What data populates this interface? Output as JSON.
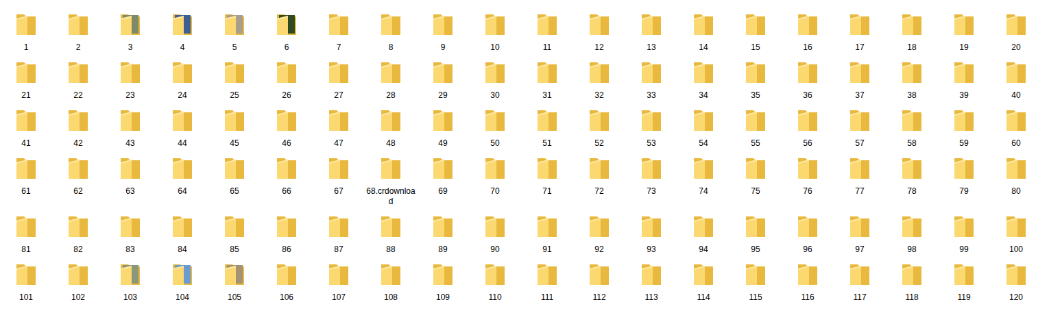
{
  "window": {
    "view": "folder-grid"
  },
  "items": [
    {
      "label": "1",
      "kind": "folder"
    },
    {
      "label": "2",
      "kind": "folder"
    },
    {
      "label": "3",
      "kind": "preview",
      "color": "#7d8a6a"
    },
    {
      "label": "4",
      "kind": "preview",
      "color": "#3d5f93"
    },
    {
      "label": "5",
      "kind": "preview",
      "color": "#a89e8c"
    },
    {
      "label": "6",
      "kind": "preview",
      "color": "#2f4a20"
    },
    {
      "label": "7",
      "kind": "folder"
    },
    {
      "label": "8",
      "kind": "folder"
    },
    {
      "label": "9",
      "kind": "folder"
    },
    {
      "label": "10",
      "kind": "folder"
    },
    {
      "label": "11",
      "kind": "folder"
    },
    {
      "label": "12",
      "kind": "folder"
    },
    {
      "label": "13",
      "kind": "folder"
    },
    {
      "label": "14",
      "kind": "folder"
    },
    {
      "label": "15",
      "kind": "folder"
    },
    {
      "label": "16",
      "kind": "folder"
    },
    {
      "label": "17",
      "kind": "folder"
    },
    {
      "label": "18",
      "kind": "folder"
    },
    {
      "label": "19",
      "kind": "folder"
    },
    {
      "label": "20",
      "kind": "folder"
    },
    {
      "label": "21",
      "kind": "folder"
    },
    {
      "label": "22",
      "kind": "folder"
    },
    {
      "label": "23",
      "kind": "folder"
    },
    {
      "label": "24",
      "kind": "folder"
    },
    {
      "label": "25",
      "kind": "folder"
    },
    {
      "label": "26",
      "kind": "folder"
    },
    {
      "label": "27",
      "kind": "folder"
    },
    {
      "label": "28",
      "kind": "folder"
    },
    {
      "label": "29",
      "kind": "folder"
    },
    {
      "label": "30",
      "kind": "folder"
    },
    {
      "label": "31",
      "kind": "folder"
    },
    {
      "label": "32",
      "kind": "folder"
    },
    {
      "label": "33",
      "kind": "folder"
    },
    {
      "label": "34",
      "kind": "folder"
    },
    {
      "label": "35",
      "kind": "folder"
    },
    {
      "label": "36",
      "kind": "folder"
    },
    {
      "label": "37",
      "kind": "folder"
    },
    {
      "label": "38",
      "kind": "folder"
    },
    {
      "label": "39",
      "kind": "folder"
    },
    {
      "label": "40",
      "kind": "folder"
    },
    {
      "label": "41",
      "kind": "folder"
    },
    {
      "label": "42",
      "kind": "folder"
    },
    {
      "label": "43",
      "kind": "folder"
    },
    {
      "label": "44",
      "kind": "folder"
    },
    {
      "label": "45",
      "kind": "folder"
    },
    {
      "label": "46",
      "kind": "folder"
    },
    {
      "label": "47",
      "kind": "folder"
    },
    {
      "label": "48",
      "kind": "folder"
    },
    {
      "label": "49",
      "kind": "folder"
    },
    {
      "label": "50",
      "kind": "folder"
    },
    {
      "label": "51",
      "kind": "folder"
    },
    {
      "label": "52",
      "kind": "folder"
    },
    {
      "label": "53",
      "kind": "folder"
    },
    {
      "label": "54",
      "kind": "folder"
    },
    {
      "label": "55",
      "kind": "folder"
    },
    {
      "label": "56",
      "kind": "folder"
    },
    {
      "label": "57",
      "kind": "folder"
    },
    {
      "label": "58",
      "kind": "folder"
    },
    {
      "label": "59",
      "kind": "folder"
    },
    {
      "label": "60",
      "kind": "folder"
    },
    {
      "label": "61",
      "kind": "folder"
    },
    {
      "label": "62",
      "kind": "folder"
    },
    {
      "label": "63",
      "kind": "folder"
    },
    {
      "label": "64",
      "kind": "folder"
    },
    {
      "label": "65",
      "kind": "folder"
    },
    {
      "label": "66",
      "kind": "folder"
    },
    {
      "label": "67",
      "kind": "folder"
    },
    {
      "label": "68.crdownload",
      "kind": "folder"
    },
    {
      "label": "69",
      "kind": "folder"
    },
    {
      "label": "70",
      "kind": "folder"
    },
    {
      "label": "71",
      "kind": "folder"
    },
    {
      "label": "72",
      "kind": "folder"
    },
    {
      "label": "73",
      "kind": "folder"
    },
    {
      "label": "74",
      "kind": "folder"
    },
    {
      "label": "75",
      "kind": "folder"
    },
    {
      "label": "76",
      "kind": "folder"
    },
    {
      "label": "77",
      "kind": "folder"
    },
    {
      "label": "78",
      "kind": "folder"
    },
    {
      "label": "79",
      "kind": "folder"
    },
    {
      "label": "80",
      "kind": "folder"
    },
    {
      "label": "81",
      "kind": "folder"
    },
    {
      "label": "82",
      "kind": "folder"
    },
    {
      "label": "83",
      "kind": "folder"
    },
    {
      "label": "84",
      "kind": "folder"
    },
    {
      "label": "85",
      "kind": "folder"
    },
    {
      "label": "86",
      "kind": "folder"
    },
    {
      "label": "87",
      "kind": "folder"
    },
    {
      "label": "88",
      "kind": "folder"
    },
    {
      "label": "89",
      "kind": "folder"
    },
    {
      "label": "90",
      "kind": "folder"
    },
    {
      "label": "91",
      "kind": "folder"
    },
    {
      "label": "92",
      "kind": "folder"
    },
    {
      "label": "93",
      "kind": "folder"
    },
    {
      "label": "94",
      "kind": "folder"
    },
    {
      "label": "95",
      "kind": "folder"
    },
    {
      "label": "96",
      "kind": "folder"
    },
    {
      "label": "97",
      "kind": "folder"
    },
    {
      "label": "98",
      "kind": "folder"
    },
    {
      "label": "99",
      "kind": "folder"
    },
    {
      "label": "100",
      "kind": "folder"
    },
    {
      "label": "101",
      "kind": "folder"
    },
    {
      "label": "102",
      "kind": "folder"
    },
    {
      "label": "103",
      "kind": "preview",
      "color": "#8a977a"
    },
    {
      "label": "104",
      "kind": "preview",
      "color": "#6b9bd1"
    },
    {
      "label": "105",
      "kind": "preview",
      "color": "#a39274"
    },
    {
      "label": "106",
      "kind": "folder"
    },
    {
      "label": "107",
      "kind": "folder"
    },
    {
      "label": "108",
      "kind": "folder"
    },
    {
      "label": "109",
      "kind": "folder"
    },
    {
      "label": "110",
      "kind": "folder"
    },
    {
      "label": "111",
      "kind": "folder"
    },
    {
      "label": "112",
      "kind": "folder"
    },
    {
      "label": "113",
      "kind": "folder"
    },
    {
      "label": "114",
      "kind": "folder"
    },
    {
      "label": "115",
      "kind": "folder"
    },
    {
      "label": "116",
      "kind": "folder"
    },
    {
      "label": "117",
      "kind": "folder"
    },
    {
      "label": "118",
      "kind": "folder"
    },
    {
      "label": "119",
      "kind": "folder"
    },
    {
      "label": "120",
      "kind": "folder"
    }
  ]
}
